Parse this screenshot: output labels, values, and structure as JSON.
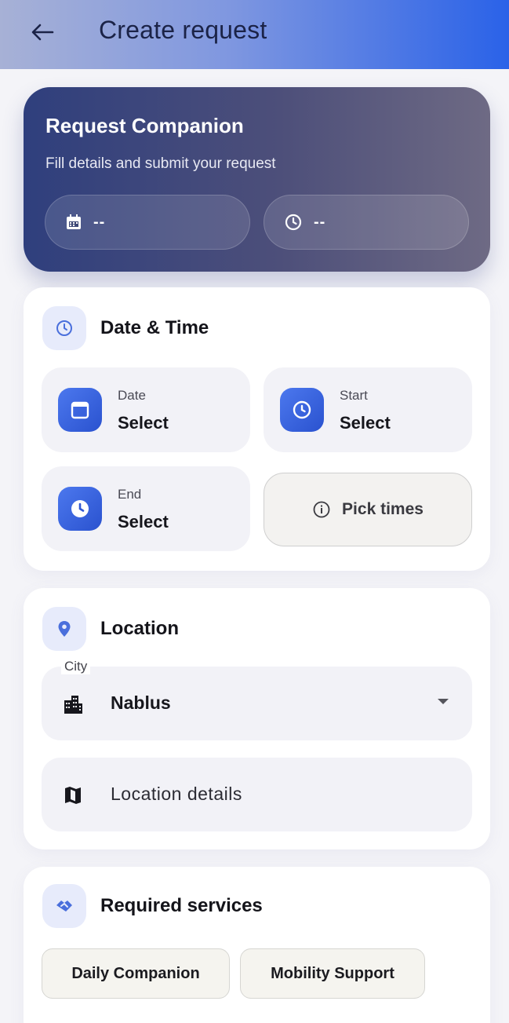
{
  "appbar": {
    "title": "Create request"
  },
  "hero": {
    "title": "Request Companion",
    "subtitle": "Fill details and submit your request",
    "date_value": "--",
    "time_value": "--"
  },
  "datetime": {
    "title": "Date & Time",
    "date": {
      "label": "Date",
      "value": "Select"
    },
    "start": {
      "label": "Start",
      "value": "Select"
    },
    "end": {
      "label": "End",
      "value": "Select"
    },
    "pick_times": "Pick times"
  },
  "location": {
    "title": "Location",
    "city_label": "City",
    "city_value": "Nablus",
    "details_placeholder": "Location details"
  },
  "services": {
    "title": "Required services",
    "chips": [
      "Daily Companion",
      "Mobility Support"
    ]
  },
  "colors": {
    "accent": "#2a62e8",
    "hero_start": "#2f3f7d",
    "icon_tile": "#3f68e0"
  }
}
